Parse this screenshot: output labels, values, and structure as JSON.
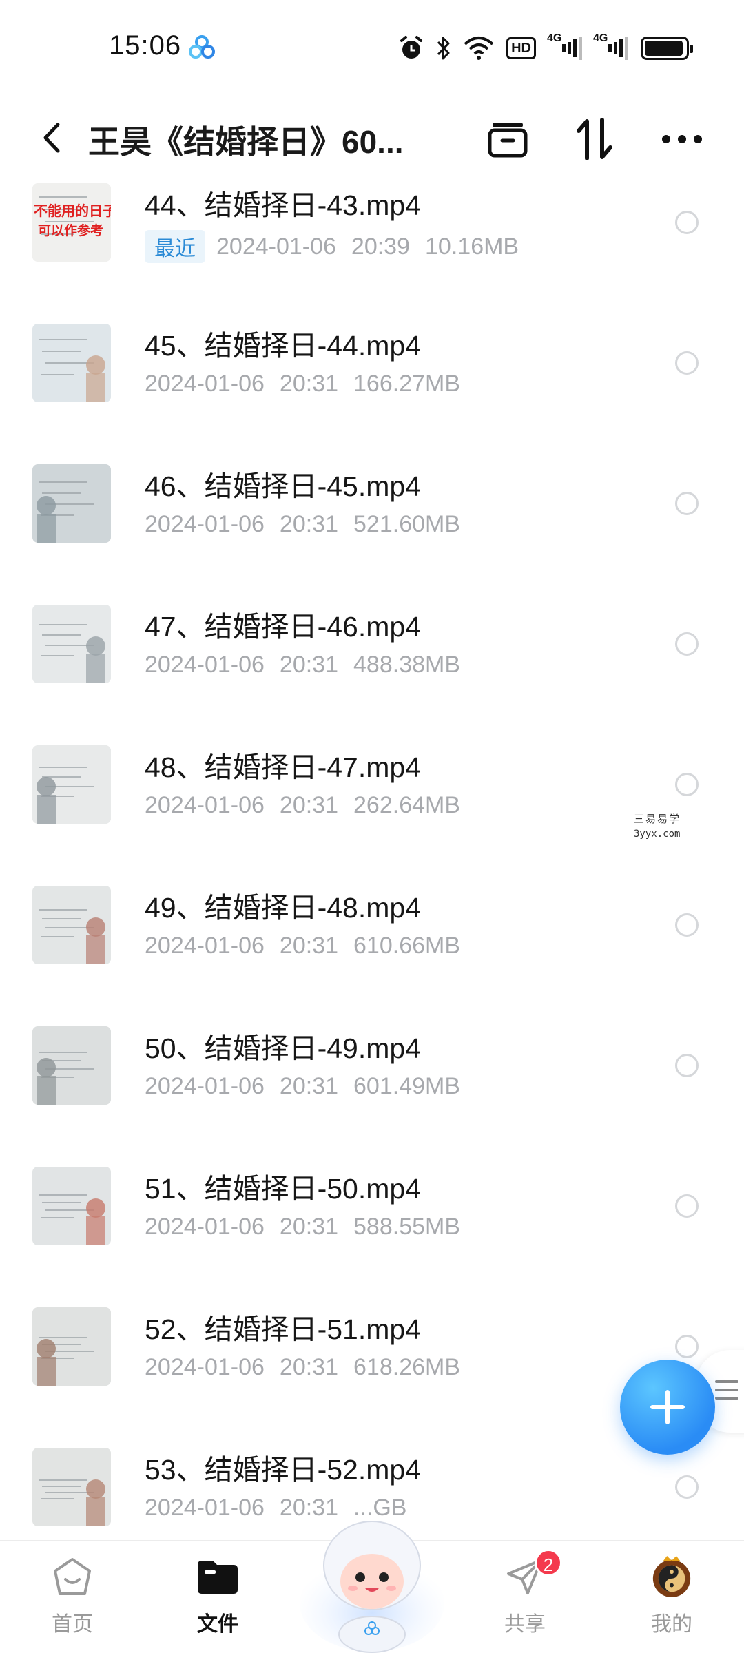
{
  "status_bar": {
    "time": "15:06",
    "hd_label": "HD",
    "network_1": "4G",
    "network_2": "4G",
    "battery_level": 0.95
  },
  "header": {
    "title": "王昊《结婚择日》60...",
    "icons": [
      "back-icon",
      "archive-icon",
      "sort-icon",
      "more-icon"
    ]
  },
  "files": [
    {
      "name": "44、结婚择日-43.mp4",
      "tag": "最近",
      "date": "2024-01-06",
      "time": "20:39",
      "size": "10.16MB"
    },
    {
      "name": "45、结婚择日-44.mp4",
      "tag": "",
      "date": "2024-01-06",
      "time": "20:31",
      "size": "166.27MB"
    },
    {
      "name": "46、结婚择日-45.mp4",
      "tag": "",
      "date": "2024-01-06",
      "time": "20:31",
      "size": "521.60MB"
    },
    {
      "name": "47、结婚择日-46.mp4",
      "tag": "",
      "date": "2024-01-06",
      "time": "20:31",
      "size": "488.38MB"
    },
    {
      "name": "48、结婚择日-47.mp4",
      "tag": "",
      "date": "2024-01-06",
      "time": "20:31",
      "size": "262.64MB"
    },
    {
      "name": "49、结婚择日-48.mp4",
      "tag": "",
      "date": "2024-01-06",
      "time": "20:31",
      "size": "610.66MB"
    },
    {
      "name": "50、结婚择日-49.mp4",
      "tag": "",
      "date": "2024-01-06",
      "time": "20:31",
      "size": "601.49MB"
    },
    {
      "name": "51、结婚择日-50.mp4",
      "tag": "",
      "date": "2024-01-06",
      "time": "20:31",
      "size": "588.55MB"
    },
    {
      "name": "52、结婚择日-51.mp4",
      "tag": "",
      "date": "2024-01-06",
      "time": "20:31",
      "size": "618.26MB"
    },
    {
      "name": "53、结婚择日-52.mp4",
      "tag": "",
      "date": "2024-01-06",
      "time": "20:31",
      "size": "...GB"
    }
  ],
  "thumb_overlay": {
    "line1": "不能用的日子",
    "line2": "可以作参考"
  },
  "watermark": {
    "line1": "三易易学",
    "line2": "3yyx.com"
  },
  "bottom_nav": {
    "home": "首页",
    "files": "文件",
    "share": "共享",
    "share_badge": "2",
    "mine": "我的"
  },
  "colors": {
    "accent": "#2a8cf5",
    "tag_bg": "#eaf4fb",
    "tag_text": "#2a8ad6",
    "meta_text": "#a7a9ad",
    "badge": "#f43a4d"
  }
}
